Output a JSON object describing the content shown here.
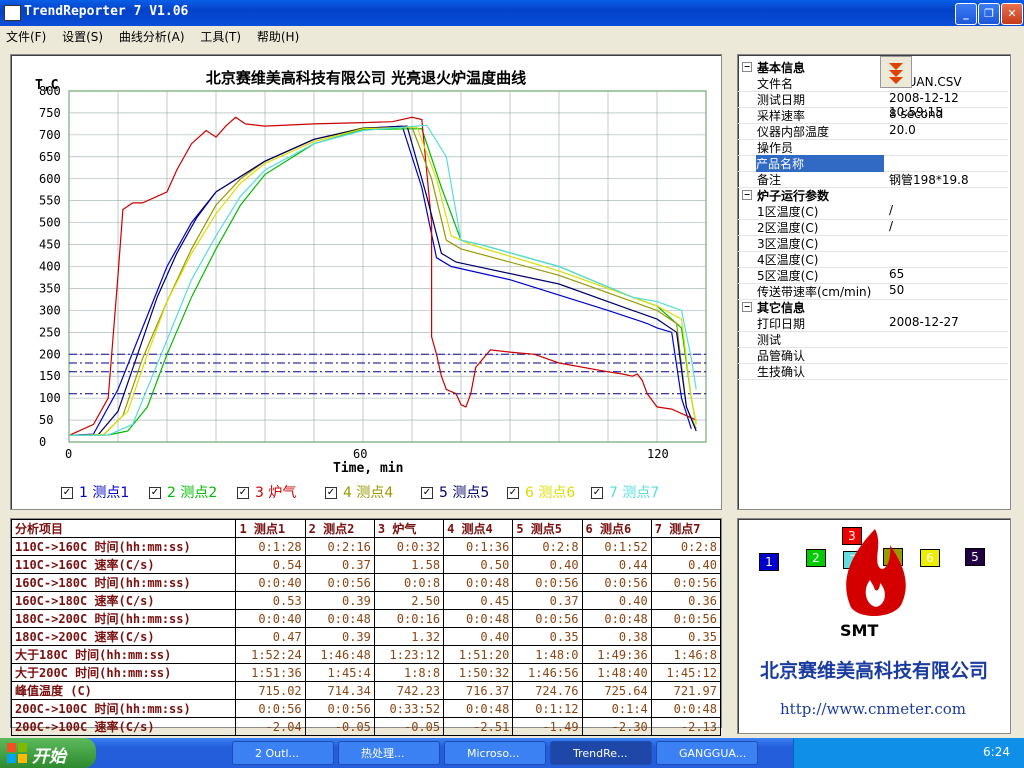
{
  "window": {
    "title": "TrendReporter 7 V1.06"
  },
  "menu": [
    "文件(F)",
    "设置(S)",
    "曲线分析(A)",
    "工具(T)",
    "帮助(H)"
  ],
  "chart": {
    "title": "北京赛维美高科技有限公司  光亮退火炉温度曲线",
    "ylabel": "T,C",
    "xlabel": "Time, min"
  },
  "chart_data": {
    "type": "line",
    "title": "北京赛维美高科技有限公司  光亮退火炉温度曲线",
    "xlabel": "Time, min",
    "ylabel": "T,C",
    "xlim": [
      0,
      130
    ],
    "ylim": [
      0,
      800
    ],
    "xticks": [
      0,
      60,
      120
    ],
    "yticks": [
      0,
      50,
      100,
      150,
      200,
      250,
      300,
      350,
      400,
      450,
      500,
      550,
      600,
      650,
      700,
      750,
      800
    ],
    "reference_lines": [
      110,
      160,
      180,
      200
    ],
    "grid": true,
    "legend_position": "bottom",
    "series": [
      {
        "name": "1 测点1",
        "color": "#0000cc",
        "points": [
          [
            0,
            15
          ],
          [
            5,
            18
          ],
          [
            10,
            120
          ],
          [
            15,
            260
          ],
          [
            20,
            400
          ],
          [
            25,
            500
          ],
          [
            30,
            570
          ],
          [
            40,
            640
          ],
          [
            50,
            690
          ],
          [
            60,
            715
          ],
          [
            68,
            720
          ],
          [
            72,
            580
          ],
          [
            75,
            420
          ],
          [
            78,
            400
          ],
          [
            90,
            370
          ],
          [
            110,
            300
          ],
          [
            118,
            270
          ],
          [
            120,
            260
          ],
          [
            123,
            250
          ],
          [
            125,
            100
          ],
          [
            127,
            30
          ]
        ]
      },
      {
        "name": "2 测点2",
        "color": "#00bb00",
        "points": [
          [
            0,
            15
          ],
          [
            8,
            16
          ],
          [
            12,
            25
          ],
          [
            16,
            80
          ],
          [
            20,
            200
          ],
          [
            25,
            330
          ],
          [
            30,
            440
          ],
          [
            35,
            540
          ],
          [
            40,
            610
          ],
          [
            50,
            680
          ],
          [
            60,
            712
          ],
          [
            72,
            714
          ],
          [
            76,
            580
          ],
          [
            80,
            460
          ],
          [
            84,
            450
          ],
          [
            100,
            400
          ],
          [
            115,
            330
          ],
          [
            120,
            310
          ],
          [
            125,
            260
          ],
          [
            127,
            100
          ],
          [
            128,
            40
          ]
        ]
      },
      {
        "name": "3 炉气",
        "color": "#cc0000",
        "points": [
          [
            0,
            15
          ],
          [
            5,
            40
          ],
          [
            8,
            100
          ],
          [
            10,
            380
          ],
          [
            11,
            530
          ],
          [
            13,
            545
          ],
          [
            15,
            545
          ],
          [
            18,
            560
          ],
          [
            20,
            570
          ],
          [
            22,
            620
          ],
          [
            25,
            680
          ],
          [
            28,
            710
          ],
          [
            30,
            695
          ],
          [
            32,
            720
          ],
          [
            34,
            740
          ],
          [
            36,
            725
          ],
          [
            40,
            720
          ],
          [
            50,
            725
          ],
          [
            60,
            728
          ],
          [
            66,
            730
          ],
          [
            70,
            740
          ],
          [
            72,
            735
          ],
          [
            74,
            500
          ],
          [
            74,
            240
          ],
          [
            75,
            200
          ],
          [
            76,
            150
          ],
          [
            77,
            120
          ],
          [
            79,
            110
          ],
          [
            80,
            85
          ],
          [
            81,
            80
          ],
          [
            82,
            110
          ],
          [
            83,
            170
          ],
          [
            86,
            210
          ],
          [
            90,
            205
          ],
          [
            95,
            200
          ],
          [
            100,
            180
          ],
          [
            110,
            160
          ],
          [
            113,
            155
          ],
          [
            115,
            150
          ],
          [
            116,
            155
          ],
          [
            117,
            140
          ],
          [
            118,
            110
          ],
          [
            120,
            80
          ],
          [
            123,
            75
          ],
          [
            126,
            60
          ],
          [
            128,
            50
          ]
        ]
      },
      {
        "name": "4 测点4",
        "color": "#999900",
        "points": [
          [
            0,
            15
          ],
          [
            7,
            16
          ],
          [
            11,
            60
          ],
          [
            15,
            190
          ],
          [
            20,
            320
          ],
          [
            25,
            440
          ],
          [
            30,
            540
          ],
          [
            35,
            600
          ],
          [
            40,
            640
          ],
          [
            50,
            690
          ],
          [
            60,
            716
          ],
          [
            70,
            718
          ],
          [
            74,
            600
          ],
          [
            77,
            460
          ],
          [
            80,
            440
          ],
          [
            100,
            380
          ],
          [
            115,
            320
          ],
          [
            120,
            300
          ],
          [
            124,
            270
          ],
          [
            126,
            80
          ],
          [
            128,
            30
          ]
        ]
      },
      {
        "name": "5 测点5",
        "color": "#000066",
        "points": [
          [
            0,
            15
          ],
          [
            6,
            17
          ],
          [
            10,
            70
          ],
          [
            14,
            200
          ],
          [
            18,
            330
          ],
          [
            22,
            430
          ],
          [
            26,
            510
          ],
          [
            30,
            570
          ],
          [
            40,
            640
          ],
          [
            50,
            690
          ],
          [
            60,
            715
          ],
          [
            69,
            720
          ],
          [
            73,
            560
          ],
          [
            76,
            430
          ],
          [
            79,
            410
          ],
          [
            100,
            360
          ],
          [
            115,
            300
          ],
          [
            120,
            280
          ],
          [
            124,
            250
          ],
          [
            126,
            80
          ],
          [
            128,
            25
          ]
        ]
      },
      {
        "name": "6 测点6",
        "color": "#dddd00",
        "points": [
          [
            0,
            15
          ],
          [
            7,
            17
          ],
          [
            12,
            70
          ],
          [
            16,
            200
          ],
          [
            20,
            320
          ],
          [
            25,
            430
          ],
          [
            30,
            520
          ],
          [
            35,
            590
          ],
          [
            40,
            635
          ],
          [
            50,
            685
          ],
          [
            60,
            714
          ],
          [
            71,
            718
          ],
          [
            75,
            600
          ],
          [
            78,
            470
          ],
          [
            82,
            450
          ],
          [
            100,
            390
          ],
          [
            115,
            330
          ],
          [
            120,
            310
          ],
          [
            125,
            280
          ],
          [
            127,
            100
          ],
          [
            128,
            40
          ]
        ]
      },
      {
        "name": "7 测点7",
        "color": "#55dddd",
        "points": [
          [
            0,
            15
          ],
          [
            8,
            16
          ],
          [
            13,
            40
          ],
          [
            17,
            150
          ],
          [
            21,
            260
          ],
          [
            25,
            370
          ],
          [
            30,
            470
          ],
          [
            35,
            560
          ],
          [
            40,
            620
          ],
          [
            50,
            680
          ],
          [
            60,
            710
          ],
          [
            73,
            722
          ],
          [
            77,
            650
          ],
          [
            80,
            460
          ],
          [
            84,
            450
          ],
          [
            100,
            400
          ],
          [
            115,
            330
          ],
          [
            120,
            320
          ],
          [
            125,
            300
          ],
          [
            127,
            190
          ],
          [
            128,
            120
          ]
        ]
      }
    ]
  },
  "legend": [
    {
      "label": "1 测点1",
      "color": "#0000cc"
    },
    {
      "label": "2 测点2",
      "color": "#00bb00"
    },
    {
      "label": "3 炉气",
      "color": "#cc0000"
    },
    {
      "label": "4 测点4",
      "color": "#999900"
    },
    {
      "label": "5 测点5",
      "color": "#000066"
    },
    {
      "label": "6 测点6",
      "color": "#dddd00"
    },
    {
      "label": "7 测点7",
      "color": "#55dddd"
    }
  ],
  "info": {
    "sections": [
      {
        "title": "基本信息",
        "rows": [
          {
            "k": "文件名",
            "v": "GGUAN.CSV"
          },
          {
            "k": "测试日期",
            "v": "2008-12-12 10:59:15"
          },
          {
            "k": "采样速率",
            "v": "8 second"
          },
          {
            "k": "仪器内部温度",
            "v": "20.0"
          },
          {
            "k": "操作员",
            "v": ""
          },
          {
            "k": "产品名称",
            "v": ""
          },
          {
            "k": "备注",
            "v": "钢管198*19.8"
          }
        ]
      },
      {
        "title": "炉子运行参数",
        "rows": [
          {
            "k": "1区温度(C)",
            "v": "/"
          },
          {
            "k": "2区温度(C)",
            "v": "/"
          },
          {
            "k": "3区温度(C)",
            "v": ""
          },
          {
            "k": "4区温度(C)",
            "v": ""
          },
          {
            "k": "5区温度(C)",
            "v": "65"
          },
          {
            "k": "传送带速率(cm/min)",
            "v": "50"
          }
        ]
      },
      {
        "title": "其它信息",
        "rows": [
          {
            "k": "打印日期",
            "v": "2008-12-27"
          },
          {
            "k": "测试",
            "v": ""
          },
          {
            "k": "品管确认",
            "v": ""
          },
          {
            "k": "生技确认",
            "v": ""
          }
        ]
      }
    ]
  },
  "analysis": {
    "headers": [
      "分析项目",
      "1 测点1",
      "2 测点2",
      "3 炉气",
      "4 测点4",
      "5 测点5",
      "6 测点6",
      "7 测点7"
    ],
    "rows": [
      [
        "110C->160C 时间(hh:mm:ss)",
        "0:1:28",
        "0:2:16",
        "0:0:32",
        "0:1:36",
        "0:2:8",
        "0:1:52",
        "0:2:8"
      ],
      [
        "110C->160C 速率(C/s)",
        "0.54",
        "0.37",
        "1.58",
        "0.50",
        "0.40",
        "0.44",
        "0.40"
      ],
      [
        "160C->180C 时间(hh:mm:ss)",
        "0:0:40",
        "0:0:56",
        "0:0:8",
        "0:0:48",
        "0:0:56",
        "0:0:56",
        "0:0:56"
      ],
      [
        "160C->180C 速率(C/s)",
        "0.53",
        "0.39",
        "2.50",
        "0.45",
        "0.37",
        "0.40",
        "0.36"
      ],
      [
        "180C->200C 时间(hh:mm:ss)",
        "0:0:40",
        "0:0:48",
        "0:0:16",
        "0:0:48",
        "0:0:56",
        "0:0:48",
        "0:0:56"
      ],
      [
        "180C->200C 速率(C/s)",
        "0.47",
        "0.39",
        "1.32",
        "0.40",
        "0.35",
        "0.38",
        "0.35"
      ],
      [
        "大于180C  时间(hh:mm:ss)",
        "1:52:24",
        "1:46:48",
        "1:23:12",
        "1:51:20",
        "1:48:0",
        "1:49:36",
        "1:46:8"
      ],
      [
        "大于200C  时间(hh:mm:ss)",
        "1:51:36",
        "1:45:4",
        "1:8:8",
        "1:50:32",
        "1:46:56",
        "1:48:40",
        "1:45:12"
      ],
      [
        "峰值温度  (C)",
        "715.02",
        "714.34",
        "742.23",
        "716.37",
        "724.76",
        "725.64",
        "721.97"
      ],
      [
        "200C->100C 时间(hh:mm:ss)",
        "0:0:56",
        "0:0:56",
        "0:33:52",
        "0:0:48",
        "0:1:12",
        "0:1:4",
        "0:0:48"
      ],
      [
        "200C->100C 速率(C/s)",
        "-2.04",
        "-0.05",
        "-0.05",
        "-2.51",
        "-1.49",
        "-2.30",
        "-2.13"
      ]
    ]
  },
  "logo": {
    "brand": "SMT",
    "company": "北京赛维美高科技有限公司",
    "url": "http://www.cnmeter.com",
    "channel_boxes": [
      {
        "n": "1",
        "color": "#0000cc"
      },
      {
        "n": "2",
        "color": "#00cc00"
      },
      {
        "n": "3",
        "color": "#ee0000"
      },
      {
        "n": "7",
        "color": "#66dddd"
      },
      {
        "n": "4",
        "color": "#999900"
      },
      {
        "n": "6",
        "color": "#eeee00"
      },
      {
        "n": "5",
        "color": "#220044"
      }
    ]
  },
  "taskbar": {
    "start": "开始",
    "tasks": [
      "2 Outl...",
      "热处理...",
      "Microso...",
      "TrendRe...",
      "GANGGUA..."
    ],
    "clock": "6:24"
  }
}
